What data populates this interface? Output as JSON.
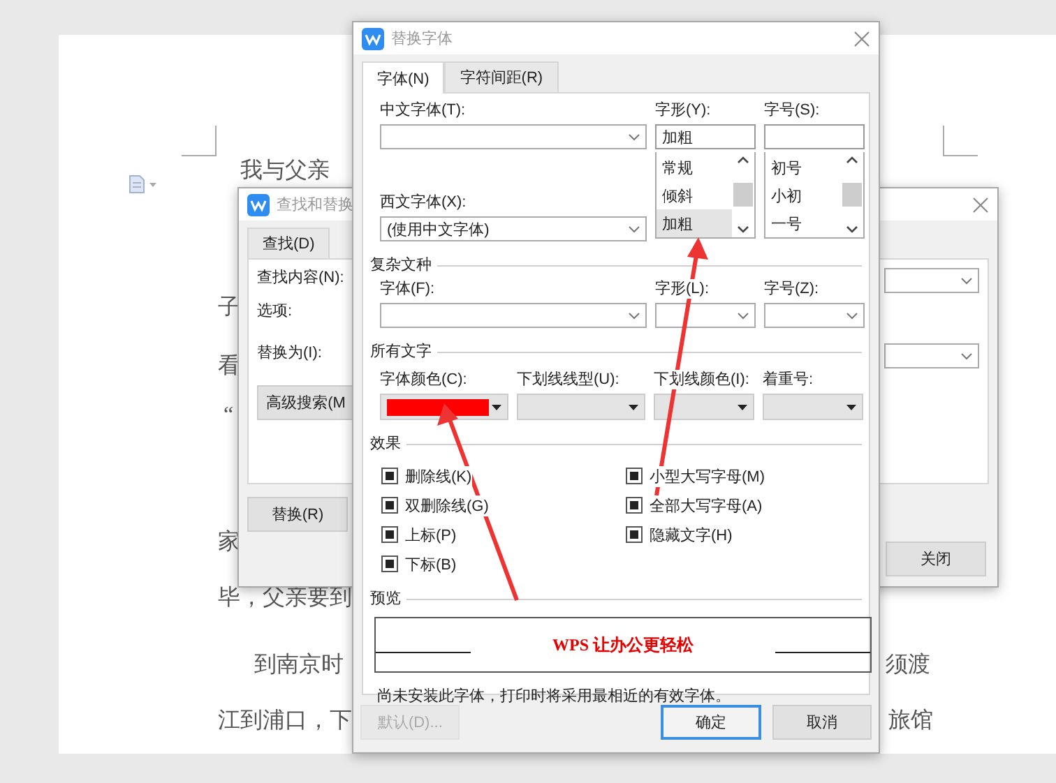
{
  "document": {
    "fragments": [
      "我与父亲",
      "子",
      "看",
      "“",
      "家",
      "毕，父亲要到",
      "到南京时",
      "江到浦口，下",
      "须渡",
      "旅馆"
    ]
  },
  "find_dialog": {
    "title": "查找和替换",
    "tabs": [
      {
        "label": "查找(D)",
        "selected": false
      }
    ],
    "labels": [
      "查找内容(N):",
      "选项:",
      "替换为(I):"
    ],
    "buttons": [
      "高级搜索(M",
      "替换(R)",
      "关闭"
    ]
  },
  "font_dialog": {
    "title": "替换字体",
    "tabs": [
      {
        "label": "字体(N)",
        "selected": true
      },
      {
        "label": "字符间距(R)",
        "selected": false
      }
    ],
    "chinese_font": {
      "label": "中文字体(T):"
    },
    "western_font": {
      "label": "西文字体(X):",
      "value": "(使用中文字体)"
    },
    "style": {
      "label": "字形(Y):",
      "value": "加粗",
      "options": [
        {
          "text": "常规",
          "selected": false
        },
        {
          "text": "倾斜",
          "selected": false
        },
        {
          "text": "加粗",
          "selected": true
        }
      ]
    },
    "size": {
      "label": "字号(S):",
      "options": [
        {
          "text": "初号",
          "selected": false
        },
        {
          "text": "小初",
          "selected": false
        },
        {
          "text": "一号",
          "selected": false
        }
      ]
    },
    "complex_script": {
      "title": "复杂文种",
      "fields": [
        {
          "label": "字体(F):"
        },
        {
          "label": "字形(L):"
        },
        {
          "label": "字号(Z):"
        }
      ]
    },
    "all_text": {
      "title": "所有文字",
      "fields": [
        {
          "label": "字体颜色(C):",
          "kind": "color",
          "color": "#ff0000"
        },
        {
          "label": "下划线线型(U):",
          "kind": "dropdown"
        },
        {
          "label": "下划线颜色(I):",
          "kind": "dropdown"
        },
        {
          "label": "着重号:",
          "kind": "dropdown"
        }
      ]
    },
    "effects": {
      "title": "效果",
      "left": [
        {
          "label": "删除线(K)",
          "checked": true
        },
        {
          "label": "双删除线(G)",
          "checked": true
        },
        {
          "label": "上标(P)",
          "checked": true
        },
        {
          "label": "下标(B)",
          "checked": true
        }
      ],
      "right": [
        {
          "label": "小型大写字母(M)",
          "checked": true
        },
        {
          "label": "全部大写字母(A)",
          "checked": true
        },
        {
          "label": "隐藏文字(H)",
          "checked": true
        }
      ]
    },
    "preview": {
      "title": "预览",
      "sample": "WPS 让办公更轻松",
      "note": "尚未安装此字体，打印时将采用最相近的有效字体。"
    },
    "buttons": [
      {
        "label": "默认(D)...",
        "disabled": true,
        "focused": false
      },
      {
        "label": "确定",
        "disabled": false,
        "focused": true
      },
      {
        "label": "取消",
        "disabled": false,
        "focused": false
      }
    ]
  }
}
